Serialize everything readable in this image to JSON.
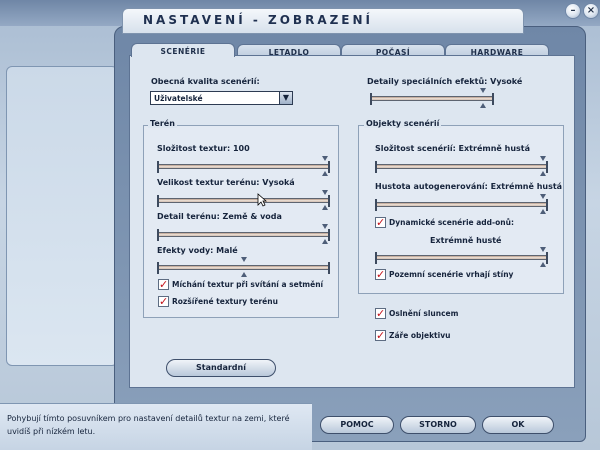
{
  "window": {
    "title": "NASTAVENÍ - ZOBRAZENÍ"
  },
  "tabs": [
    {
      "label": "SCENÉRIE"
    },
    {
      "label": "LETADLO"
    },
    {
      "label": "POČASÍ"
    },
    {
      "label": "HARDWARE"
    }
  ],
  "scenery": {
    "general_quality_label": "Obecná kvalita scenérií:",
    "general_quality_value": "Uživatelské",
    "special_effects_label": "Detaily speciálních efektů: Vysoké",
    "special_effects_level": 0.95
  },
  "terrain": {
    "title": "Terén",
    "texture_complexity_label": "Složitost textur: 100",
    "texture_complexity_level": 1.0,
    "terrain_texture_size_label": "Velikost textur terénu: Vysoká",
    "terrain_texture_size_level": 1.0,
    "terrain_detail_label": "Detail terénu: Země & voda",
    "terrain_detail_level": 1.0,
    "water_effects_label": "Efekty vody: Malé",
    "water_effects_level": 0.5,
    "blend_textures_label": "Míchání textur při svítání a setmění",
    "blend_textures_checked": true,
    "extended_textures_label": "Rozšířené textury terénu",
    "extended_textures_checked": true
  },
  "objects": {
    "title": "Objekty scenérií",
    "scenery_complexity_label": "Složitost scenérií: Extrémně hustá",
    "scenery_complexity_level": 1.0,
    "autogen_density_label": "Hustota autogenerování: Extrémně hustá",
    "autogen_density_level": 1.0,
    "dynamic_scenery_label": "Dynamické scenérie add-onů:",
    "dynamic_scenery_checked": true,
    "dynamic_scenery_value": "Extrémně husté",
    "dynamic_scenery_level": 1.0,
    "ground_shadows_label": "Pozemní scenérie vrhají stíny",
    "ground_shadows_checked": true
  },
  "effects": {
    "sun_glare_label": "Oslnění sluncem",
    "sun_glare_checked": true,
    "lens_flare_label": "Záře objektivu",
    "lens_flare_checked": true
  },
  "buttons": {
    "default": "Standardní",
    "help": "POMOC",
    "cancel": "STORNO",
    "ok": "OK"
  },
  "help": {
    "text": "Pohybují tímto posuvníkem pro nastavení detailů textur na zemi, které uvidíš při nízkém letu."
  },
  "icons": {
    "minimize": "minimize-icon",
    "close": "close-icon",
    "dropdown": "chevron-down-icon",
    "check_color": "#c4121a"
  }
}
